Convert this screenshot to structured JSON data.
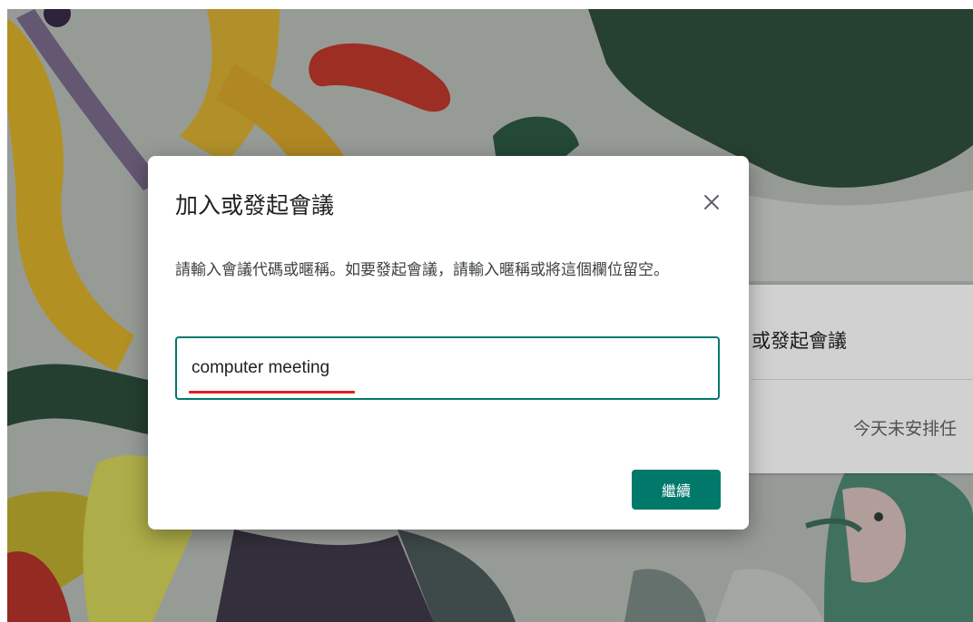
{
  "background_card": {
    "title": "或發起會議",
    "empty_text": "今天未安排任"
  },
  "dialog": {
    "title": "加入或發起會議",
    "description": "請輸入會議代碼或暱稱。如要發起會議，請輸入暱稱或將這個欄位留空。",
    "input_value": "computer meeting",
    "continue_label": "繼續",
    "close_icon": "close-icon"
  },
  "colors": {
    "accent": "#00796b",
    "annotation_underline": "#e02020"
  }
}
